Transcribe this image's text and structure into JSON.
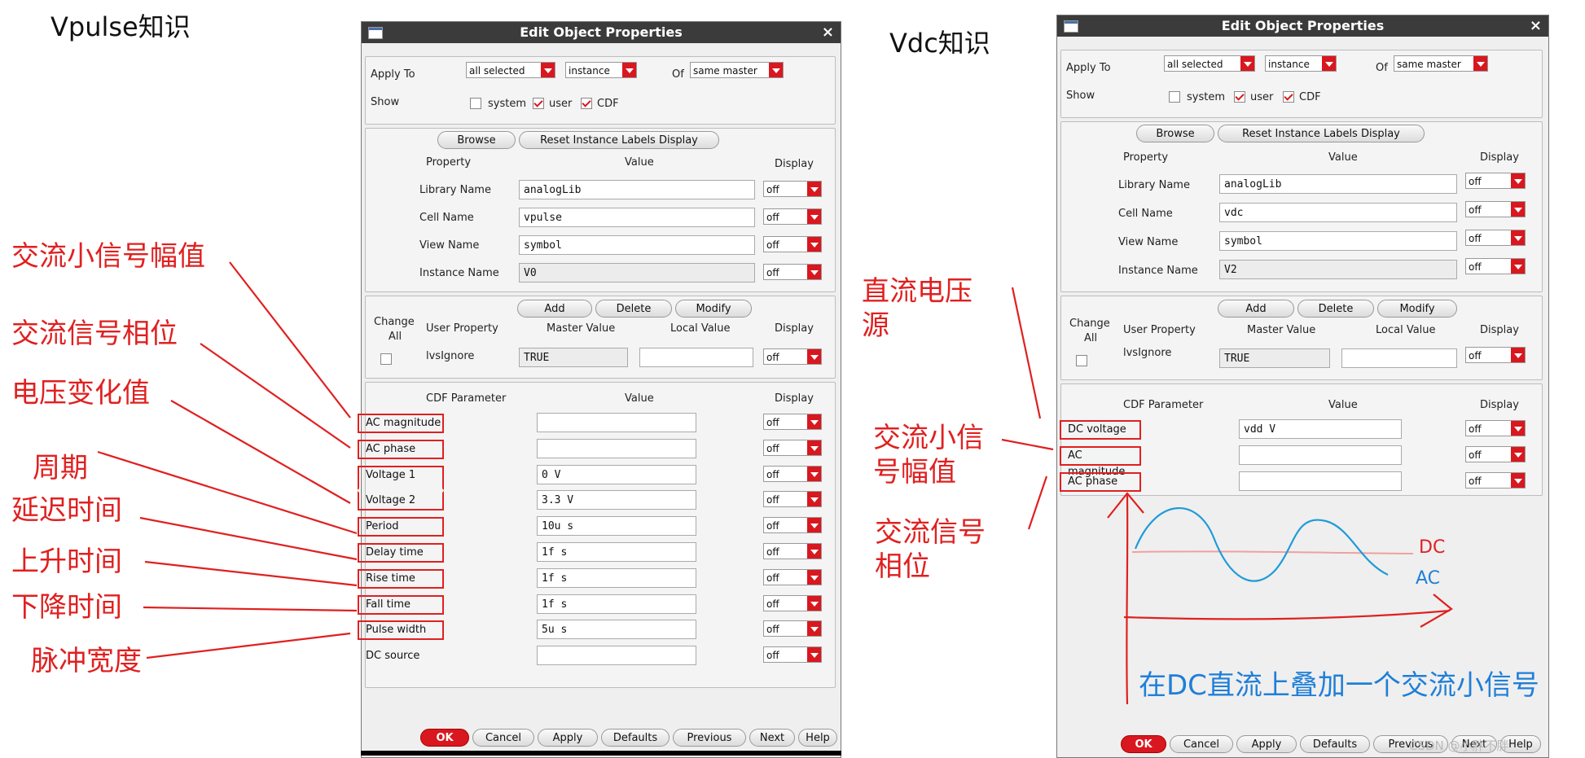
{
  "left_title": "Vpulse知识",
  "right_title": "Vdc知识",
  "colors": {
    "accent": "#d9171f",
    "annotation_red": "#e02020",
    "annotation_blue": "#1f7fd8"
  },
  "dialog_title": "Edit Object Properties",
  "apply_to_label": "Apply To",
  "apply_to_value": "all selected",
  "apply_scope_value": "instance",
  "of_label": "Of",
  "of_value": "same master",
  "show_label": "Show",
  "show_system": "system",
  "show_user": "user",
  "show_cdf": "CDF",
  "browse": "Browse",
  "reset_labels": "Reset Instance Labels Display",
  "col_property": "Property",
  "col_value": "Value",
  "col_display": "Display",
  "library_name_label": "Library Name",
  "cell_name_label": "Cell Name",
  "view_name_label": "View Name",
  "instance_name_label": "Instance Name",
  "add": "Add",
  "delete": "Delete",
  "modify": "Modify",
  "change_all_1": "Change",
  "change_all_2": "All",
  "col_user_property": "User Property",
  "col_master_value": "Master Value",
  "col_local_value": "Local Value",
  "ivsignore": "lvsIgnore",
  "true_value": "TRUE",
  "col_cdf_parameter": "CDF Parameter",
  "off": "off",
  "btn_ok": "OK",
  "btn_cancel": "Cancel",
  "btn_apply": "Apply",
  "btn_defaults": "Defaults",
  "btn_previous": "Previous",
  "btn_next": "Next",
  "btn_help": "Help",
  "left_dialog": {
    "library_name": "analogLib",
    "cell_name": "vpulse",
    "view_name": "symbol",
    "instance_name": "V0",
    "cdf": [
      {
        "label": "AC magnitude",
        "value": ""
      },
      {
        "label": "AC phase",
        "value": ""
      },
      {
        "label": "Voltage 1",
        "value": "0 V"
      },
      {
        "label": "Voltage 2",
        "value": "3.3 V"
      },
      {
        "label": "Period",
        "value": "10u s"
      },
      {
        "label": "Delay time",
        "value": "1f s"
      },
      {
        "label": "Rise time",
        "value": "1f s"
      },
      {
        "label": "Fall time",
        "value": "1f s"
      },
      {
        "label": "Pulse width",
        "value": "5u s"
      },
      {
        "label": "DC source",
        "value": ""
      }
    ]
  },
  "right_dialog": {
    "library_name": "analogLib",
    "cell_name": "vdc",
    "view_name": "symbol",
    "instance_name": "V2",
    "cdf": [
      {
        "label": "DC voltage",
        "value": "vdd V"
      },
      {
        "label": "AC magnitude",
        "value": ""
      },
      {
        "label": "AC phase",
        "value": ""
      }
    ]
  },
  "left_annotations": {
    "ac_mag": "交流小信号幅值",
    "ac_phase": "交流信号相位",
    "voltage_change": "电压变化值",
    "period": "周期",
    "delay": "延迟时间",
    "rise": "上升时间",
    "fall": "下降时间",
    "pulse": "脉冲宽度"
  },
  "right_annotations": {
    "dc_source_1": "直流电压",
    "dc_source_2": "源",
    "ac_mag_1": "交流小信",
    "ac_mag_2": "号幅值",
    "ac_phase_1": "交流信号",
    "ac_phase_2": "相位",
    "dc": "DC",
    "ac": "AC",
    "summary": "在DC直流上叠加一个交流小信号",
    "watermark": "CSDN @小胖不胖"
  }
}
